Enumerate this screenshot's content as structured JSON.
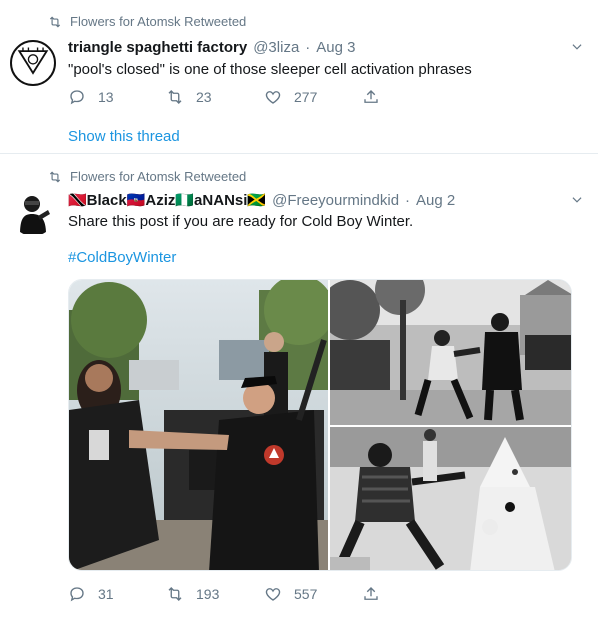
{
  "tweets": [
    {
      "retweet_label": "Flowers for Atomsk Retweeted",
      "name": "triangle spaghetti factory",
      "handle": "@3liza",
      "separator": "·",
      "date": "Aug 3",
      "text": "\"pool's closed\" is one of those sleeper cell activation phrases",
      "replies": "13",
      "retweets": "23",
      "likes": "277",
      "show_thread": "Show this thread"
    },
    {
      "retweet_label": "Flowers for Atomsk Retweeted",
      "name": "🇹🇹Black🇭🇹Aziz🇳🇬aNANsi🇯🇲",
      "handle": "@Freeyourmindkid",
      "separator": "·",
      "date": "Aug 2",
      "text": "Share this post if you are ready for Cold Boy Winter.",
      "hashtag": "#ColdBoyWinter",
      "replies": "31",
      "retweets": "193",
      "likes": "557"
    }
  ],
  "colors": {
    "link": "#1b95e0",
    "secondary": "#657786",
    "primary_text": "#14171a",
    "divider": "#e6ecf0"
  },
  "icons": [
    "retweet-icon",
    "reply-icon",
    "like-icon",
    "share-icon",
    "chevron-down-icon"
  ]
}
